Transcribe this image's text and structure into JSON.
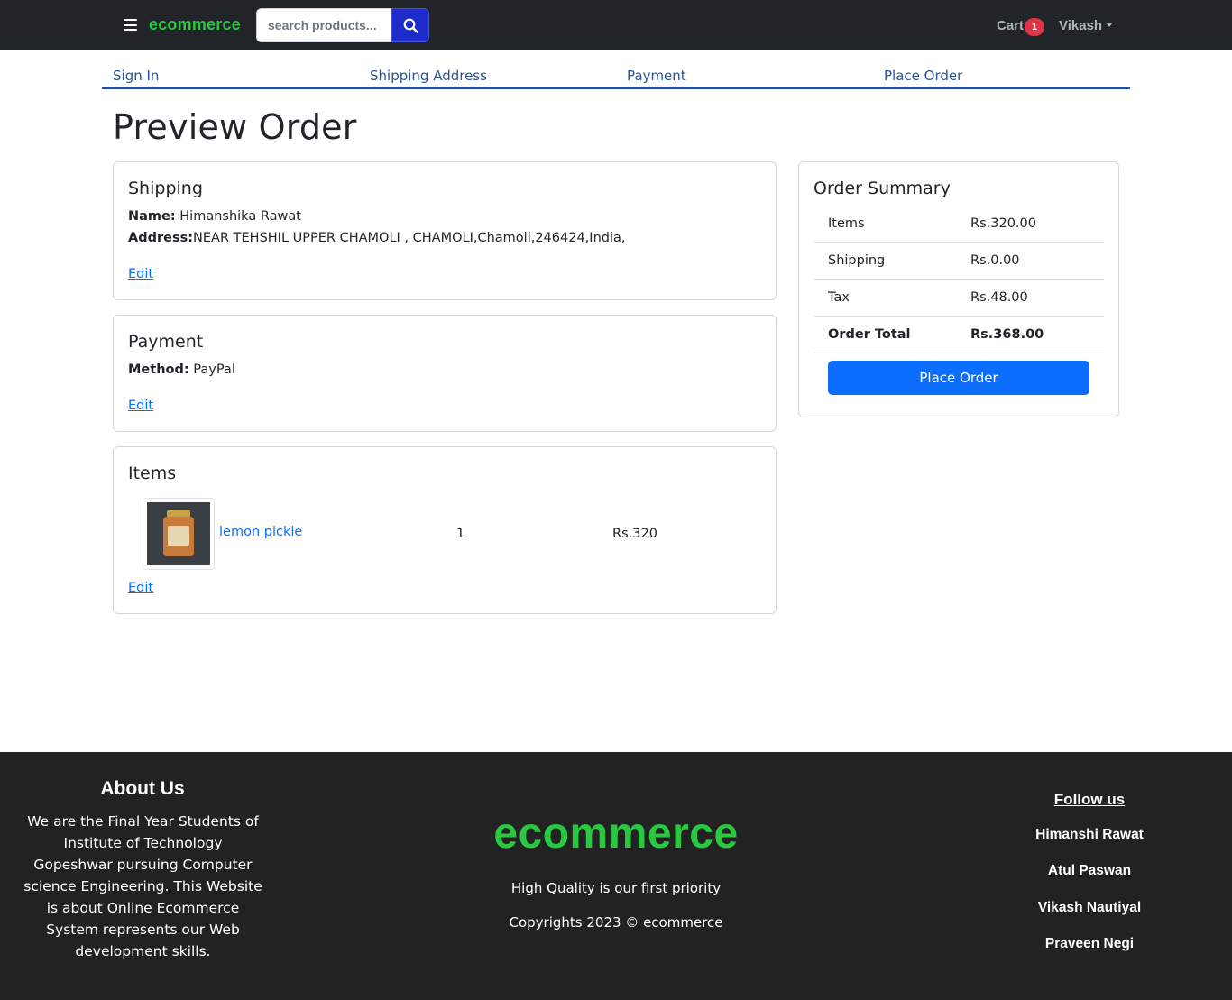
{
  "navbar": {
    "brand": "ecommerce",
    "search_placeholder": "search products...",
    "cart_label": "Cart",
    "cart_count": "1",
    "user_name": "Vikash",
    "colors": {
      "background": "#212529",
      "brand": "#28c840",
      "search_button": "#1d2bcc",
      "badge": "#dc3545"
    }
  },
  "steps": [
    "Sign In",
    "Shipping Address",
    "Payment",
    "Place Order"
  ],
  "page_title": "Preview Order",
  "shipping": {
    "title": "Shipping",
    "name_label": "Name:",
    "name_value": "Himanshika Rawat",
    "address_label": "Address:",
    "address_value": "NEAR TEHSHIL UPPER CHAMOLI , CHAMOLI,Chamoli,246424,India,",
    "edit_label": "Edit"
  },
  "payment": {
    "title": "Payment",
    "method_label": "Method:",
    "method_value": "PayPal",
    "edit_label": "Edit"
  },
  "items": {
    "title": "Items",
    "list": [
      {
        "name": "lemon pickle",
        "quantity": "1",
        "price": "Rs.320",
        "image_icon": "pickle-jar-image"
      }
    ],
    "edit_label": "Edit"
  },
  "summary": {
    "title": "Order Summary",
    "rows": [
      {
        "label": "Items",
        "value": "Rs.320.00"
      },
      {
        "label": "Shipping",
        "value": "Rs.0.00"
      },
      {
        "label": "Tax",
        "value": "Rs.48.00"
      },
      {
        "label": "Order Total",
        "value": "Rs.368.00"
      }
    ],
    "button_label": "Place Order",
    "button_color": "#0d6efd"
  },
  "footer": {
    "about_title": "About Us",
    "about_text": "We are the Final Year Students of Institute of Technology Gopeshwar pursuing Computer science Engineering. This Website is about Online Ecommerce System represents our Web development skills.",
    "brand": "ecommerce",
    "tagline": "High Quality is our first priority",
    "copyright": "Copyrights 2023 © ecommerce",
    "follow_title": "Follow us",
    "members": [
      "Himanshi Rawat",
      "Atul Paswan",
      "Vikash Nautiyal",
      "Praveen Negi"
    ]
  }
}
